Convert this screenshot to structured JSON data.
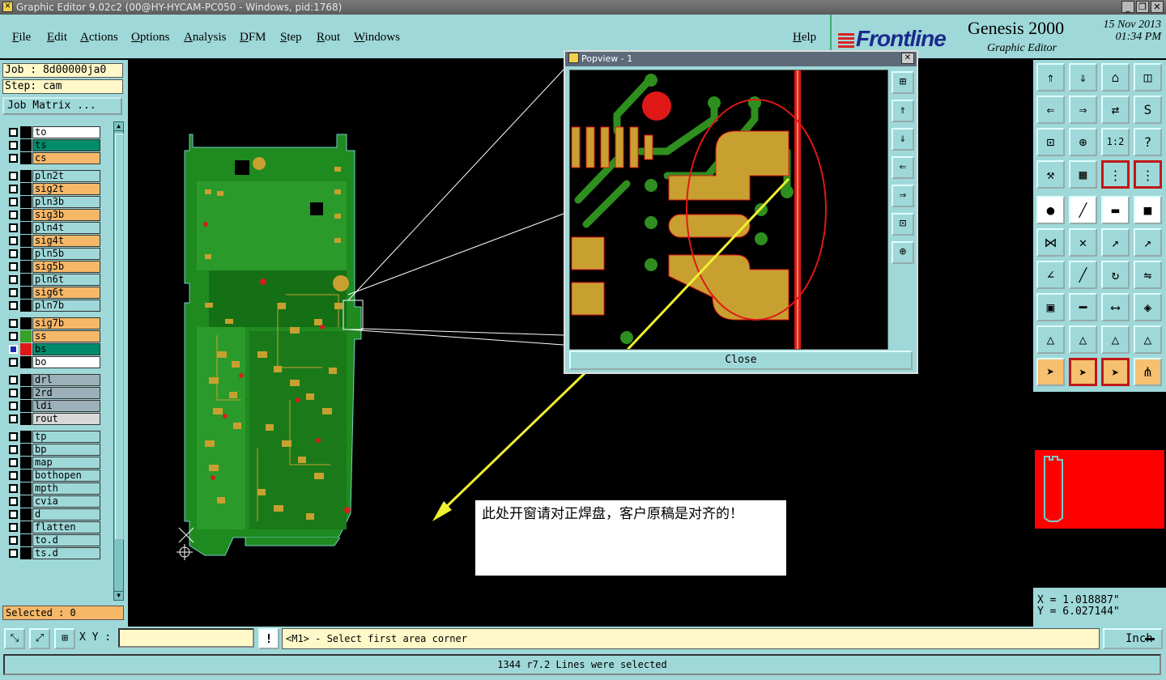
{
  "window": {
    "title": "Graphic Editor 9.02c2 (00@HY-HYCAM-PC050 - Windows, pid:1768)",
    "controls": {
      "minimize": "_",
      "restore": "❐",
      "close": "✕"
    }
  },
  "menu": {
    "items": [
      "File",
      "Edit",
      "Actions",
      "Options",
      "Analysis",
      "DFM",
      "Step",
      "Rout",
      "Windows"
    ],
    "help": "Help"
  },
  "brand": {
    "logo": "Frontline",
    "product": "Genesis 2000",
    "subtitle": "Graphic Editor",
    "date": "15 Nov 2013",
    "time": "01:34 PM"
  },
  "left_panel": {
    "job": "Job : 8d00000ja0",
    "step": "Step: cam",
    "job_matrix": "Job Matrix ...",
    "selected": "Selected : 0",
    "layers": [
      {
        "name": "to",
        "bg": "#ffffff",
        "swatch": "#000000"
      },
      {
        "name": "ts",
        "bg": "#008c6a",
        "swatch": "#000000"
      },
      {
        "name": "cs",
        "bg": "#f5b868",
        "swatch": "#000000"
      },
      {
        "name": "pln2t",
        "bg": "#9fd8d8",
        "swatch": "#000000"
      },
      {
        "name": "sig2t",
        "bg": "#f5b868",
        "swatch": "#000000"
      },
      {
        "name": "pln3b",
        "bg": "#9fd8d8",
        "swatch": "#000000"
      },
      {
        "name": "sig3b",
        "bg": "#f5b868",
        "swatch": "#000000"
      },
      {
        "name": "pln4t",
        "bg": "#9fd8d8",
        "swatch": "#000000"
      },
      {
        "name": "sig4t",
        "bg": "#f5b868",
        "swatch": "#000000"
      },
      {
        "name": "pln5b",
        "bg": "#9fd8d8",
        "swatch": "#000000"
      },
      {
        "name": "sig5b",
        "bg": "#f5b868",
        "swatch": "#000000"
      },
      {
        "name": "pln6t",
        "bg": "#9fd8d8",
        "swatch": "#000000"
      },
      {
        "name": "sig6t",
        "bg": "#f5b868",
        "swatch": "#000000"
      },
      {
        "name": "pln7b",
        "bg": "#9fd8d8",
        "swatch": "#000000"
      },
      {
        "name": "sig7b",
        "bg": "#f5b868",
        "swatch": "#000000"
      },
      {
        "name": "ss",
        "bg": "#f5b868",
        "swatch": "#3aa02a"
      },
      {
        "name": "bs",
        "bg": "#008c6a",
        "swatch": "#e01818",
        "active": true
      },
      {
        "name": "bo",
        "bg": "#ffffff",
        "swatch": "#000000"
      },
      {
        "name": "drl",
        "bg": "#9bb0b8",
        "swatch": "#000000"
      },
      {
        "name": "2rd",
        "bg": "#9bb0b8",
        "swatch": "#000000"
      },
      {
        "name": "ldi",
        "bg": "#9bb0b8",
        "swatch": "#000000"
      },
      {
        "name": "rout",
        "bg": "#d8d8d8",
        "swatch": "#000000"
      },
      {
        "name": "tp",
        "bg": "#9fd8d8",
        "swatch": "#000000"
      },
      {
        "name": "bp",
        "bg": "#9fd8d8",
        "swatch": "#000000"
      },
      {
        "name": "map",
        "bg": "#9fd8d8",
        "swatch": "#000000"
      },
      {
        "name": "bothopen",
        "bg": "#9fd8d8",
        "swatch": "#000000"
      },
      {
        "name": "mpth",
        "bg": "#9fd8d8",
        "swatch": "#000000"
      },
      {
        "name": "cvia",
        "bg": "#9fd8d8",
        "swatch": "#000000"
      },
      {
        "name": "d",
        "bg": "#9fd8d8",
        "swatch": "#000000"
      },
      {
        "name": "flatten",
        "bg": "#9fd8d8",
        "swatch": "#000000"
      },
      {
        "name": "to.d",
        "bg": "#9fd8d8",
        "swatch": "#000000"
      },
      {
        "name": "ts.d",
        "bg": "#9fd8d8",
        "swatch": "#000000"
      }
    ]
  },
  "popview": {
    "title": "Popview - 1",
    "close_label": "Close"
  },
  "annotation": {
    "text": "此处开窗请对正焊盘，客户原稿是对齐的！"
  },
  "right_tools": {
    "rows": [
      [
        "top-icon",
        "down-icon",
        "home-icon",
        "split-icon"
      ],
      [
        "left-icon",
        "right-icon",
        "swap-icon",
        "s-curve-icon"
      ],
      [
        "zoom-fit-icon",
        "zoom-center-icon",
        "scale-icon",
        "help-icon"
      ],
      [
        "measure-icon",
        "grid-icon",
        "layer-pair-icon",
        "layer-pair-icon"
      ]
    ],
    "tools": [
      [
        "dot-arrow-icon",
        "draw-line-icon",
        "ruler-icon",
        "square-dot-icon"
      ],
      [
        "nodes-icon",
        "cross-icon",
        "move-icon",
        "pointer-arrow-icon"
      ],
      [
        "angle-icon",
        "line-icon",
        "rotate-icon",
        "mirror-icon"
      ],
      [
        "dot-square-icon",
        "minus-icon",
        "dimension-icon",
        "shapes-icon"
      ],
      [
        "triangle-icon",
        "triangle-icon",
        "triangle-icon",
        "triangle-icon"
      ],
      [
        "cursor-icon",
        "cursor-icon",
        "cursor-icon",
        "network-icon"
      ]
    ],
    "glyphs": {
      "top-icon": "⇑",
      "down-icon": "⇓",
      "home-icon": "⌂",
      "split-icon": "◫",
      "left-icon": "⇐",
      "right-icon": "⇒",
      "swap-icon": "⇄",
      "s-curve-icon": "S",
      "zoom-fit-icon": "⊡",
      "zoom-center-icon": "⊕",
      "scale-icon": "1:2",
      "help-icon": "?",
      "measure-icon": "⚒",
      "grid-icon": "▦",
      "layer-pair-icon": "⋮",
      "dot-arrow-icon": "●",
      "draw-line-icon": "╱",
      "ruler-icon": "▬",
      "square-dot-icon": "■",
      "nodes-icon": "⋈",
      "cross-icon": "✕",
      "move-icon": "↗",
      "pointer-arrow-icon": "↗",
      "angle-icon": "∠",
      "line-icon": "╱",
      "rotate-icon": "↻",
      "mirror-icon": "⇋",
      "dot-square-icon": "▣",
      "minus-icon": "━",
      "dimension-icon": "⟷",
      "shapes-icon": "◈",
      "triangle-icon": "△",
      "cursor-icon": "➤",
      "network-icon": "⋔"
    }
  },
  "coords": {
    "x": "X = 1.018887\"",
    "y": "Y = 6.027144\""
  },
  "bottom": {
    "xy_label": "X Y :",
    "xy_value": "",
    "warn": "!",
    "prompt": "<M1> - Select first area corner",
    "units": "Inch",
    "status": "1344 r7.2 Lines were selected"
  }
}
